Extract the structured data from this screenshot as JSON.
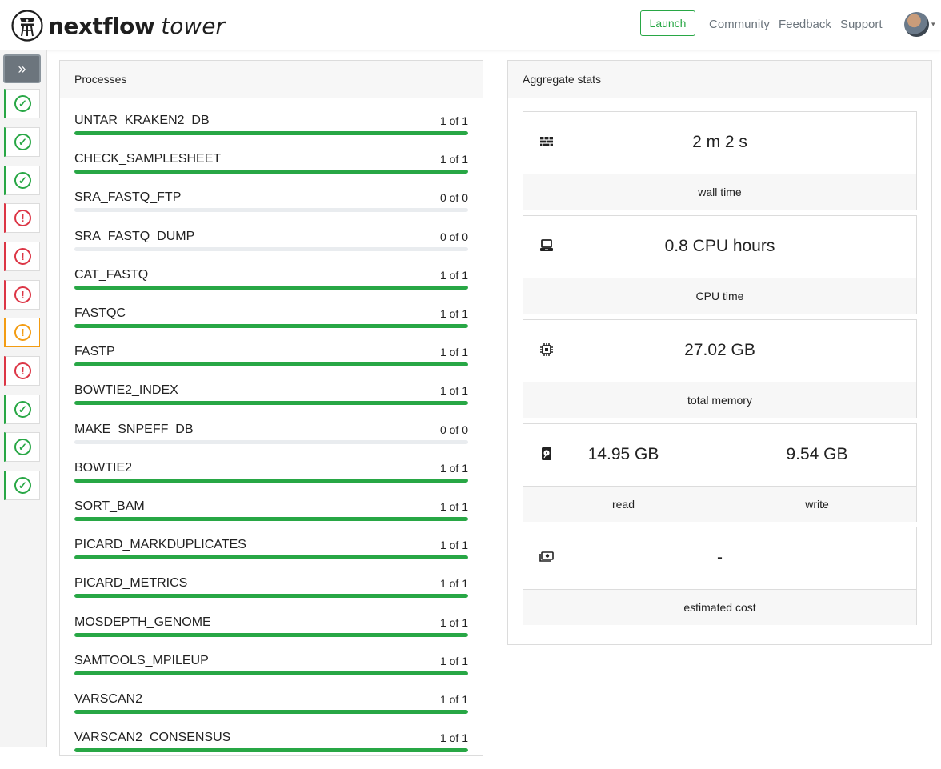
{
  "header": {
    "brand": "nextflow",
    "brand_sub": "tower",
    "launch_label": "Launch",
    "nav": [
      "Community",
      "Feedback",
      "Support"
    ],
    "caret": "▾"
  },
  "sidebar": {
    "expand_label": "»",
    "runs": [
      {
        "status": "succeeded",
        "color": "#28a745"
      },
      {
        "status": "succeeded",
        "color": "#28a745"
      },
      {
        "status": "succeeded",
        "color": "#28a745"
      },
      {
        "status": "failed",
        "color": "#dc3545"
      },
      {
        "status": "failed",
        "color": "#dc3545"
      },
      {
        "status": "failed",
        "color": "#dc3545"
      },
      {
        "status": "warning",
        "color": "#f39c12"
      },
      {
        "status": "failed",
        "color": "#dc3545"
      },
      {
        "status": "succeeded",
        "color": "#28a745"
      },
      {
        "status": "succeeded",
        "color": "#28a745"
      },
      {
        "status": "succeeded",
        "color": "#28a745"
      }
    ]
  },
  "processes": {
    "title": "Processes",
    "items": [
      {
        "name": "UNTAR_KRAKEN2_DB",
        "count": "1 of 1",
        "progress": 1
      },
      {
        "name": "CHECK_SAMPLESHEET",
        "count": "1 of 1",
        "progress": 1
      },
      {
        "name": "SRA_FASTQ_FTP",
        "count": "0 of 0",
        "progress": 0
      },
      {
        "name": "SRA_FASTQ_DUMP",
        "count": "0 of 0",
        "progress": 0
      },
      {
        "name": "CAT_FASTQ",
        "count": "1 of 1",
        "progress": 1
      },
      {
        "name": "FASTQC",
        "count": "1 of 1",
        "progress": 1
      },
      {
        "name": "FASTP",
        "count": "1 of 1",
        "progress": 1
      },
      {
        "name": "BOWTIE2_INDEX",
        "count": "1 of 1",
        "progress": 1
      },
      {
        "name": "MAKE_SNPEFF_DB",
        "count": "0 of 0",
        "progress": 0
      },
      {
        "name": "BOWTIE2",
        "count": "1 of 1",
        "progress": 1
      },
      {
        "name": "SORT_BAM",
        "count": "1 of 1",
        "progress": 1
      },
      {
        "name": "PICARD_MARKDUPLICATES",
        "count": "1 of 1",
        "progress": 1
      },
      {
        "name": "PICARD_METRICS",
        "count": "1 of 1",
        "progress": 1
      },
      {
        "name": "MOSDEPTH_GENOME",
        "count": "1 of 1",
        "progress": 1
      },
      {
        "name": "SAMTOOLS_MPILEUP",
        "count": "1 of 1",
        "progress": 1
      },
      {
        "name": "VARSCAN2",
        "count": "1 of 1",
        "progress": 1
      },
      {
        "name": "VARSCAN2_CONSENSUS",
        "count": "1 of 1",
        "progress": 1
      }
    ],
    "bar_color": "#28a745"
  },
  "aggregate": {
    "title": "Aggregate stats",
    "wall": {
      "icon": "wall-icon",
      "value": "2 m 2 s",
      "label": "wall time"
    },
    "cpu": {
      "icon": "laptop-icon",
      "value": "0.8 CPU hours",
      "label": "CPU time"
    },
    "memory": {
      "icon": "chip-icon",
      "value": "27.02 GB",
      "label": "total memory"
    },
    "io": {
      "icon": "harddisk-icon",
      "read_value": "14.95 GB",
      "write_value": "9.54 GB",
      "read_label": "read",
      "write_label": "write"
    },
    "cost": {
      "icon": "money-icon",
      "value": "-",
      "label": "estimated cost"
    }
  }
}
